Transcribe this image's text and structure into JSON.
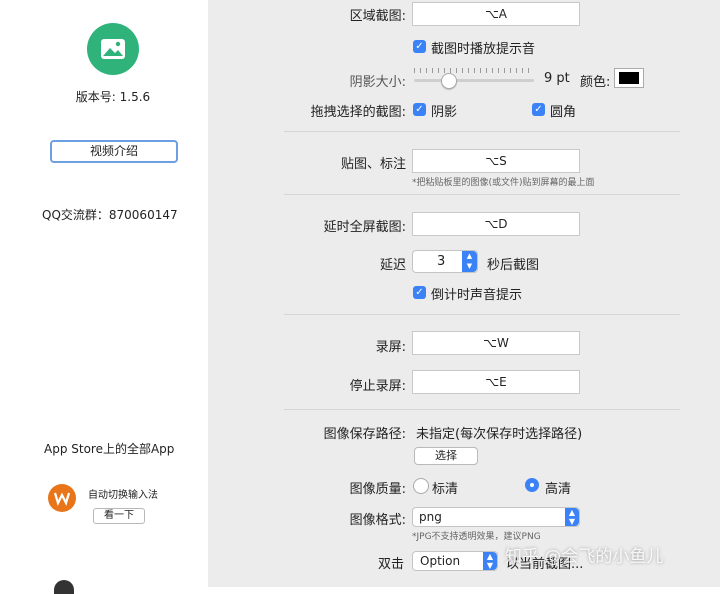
{
  "sidebar": {
    "version": "版本号: 1.5.6",
    "video_button": "视频介绍",
    "qq_group": "QQ交流群：870060147",
    "appstore_title": "App Store上的全部App",
    "app_name": "自动切换输入法",
    "app_view_button": "看一下",
    "colors": {
      "app_icon": "#2fb37a",
      "other_app_icon": "#e8751a"
    }
  },
  "settings": {
    "region_capture": {
      "label": "区域截图:",
      "hotkey": "⌥A"
    },
    "play_sound": {
      "label": "截图时播放提示音",
      "checked": true
    },
    "shadow_size": {
      "label": "阴影大小:",
      "value": "9 pt",
      "level": 0.25
    },
    "color_label": "颜色:",
    "shadow_color": "#000000",
    "drag_capture": {
      "label": "拖拽选择的截图:",
      "shadow": "阴影",
      "rounded": "圆角"
    },
    "paste_annotate": {
      "label": "贴图、标注",
      "hotkey": "⌥S",
      "note": "*把粘贴板里的图像(或文件)贴到屏幕的最上面"
    },
    "delayed_fullscreen": {
      "label": "延时全屏截图:",
      "hotkey": "⌥D"
    },
    "delay": {
      "label": "延迟",
      "value": "3",
      "suffix": "秒后截图"
    },
    "countdown_sound": {
      "label": "倒计时声音提示",
      "checked": true
    },
    "record": {
      "label": "录屏:",
      "hotkey": "⌥W"
    },
    "stop_record": {
      "label": "停止录屏:",
      "hotkey": "⌥E"
    },
    "save_path": {
      "label": "图像保存路径:",
      "value": "未指定(每次保存时选择路径)",
      "choose_button": "选择"
    },
    "quality": {
      "label": "图像质量:",
      "standard": "标清",
      "high": "高清",
      "selected": "high"
    },
    "format": {
      "label": "图像格式:",
      "value": "png",
      "note": "*JPG不支持透明效果，建议PNG"
    },
    "double_click": {
      "label": "双击",
      "modifier": "Option",
      "action": "以当前截图..."
    }
  },
  "watermark": "知乎 @会飞的小鱼儿",
  "colors": {
    "accent": "#3b82f6",
    "panel_bg": "#ececec"
  }
}
